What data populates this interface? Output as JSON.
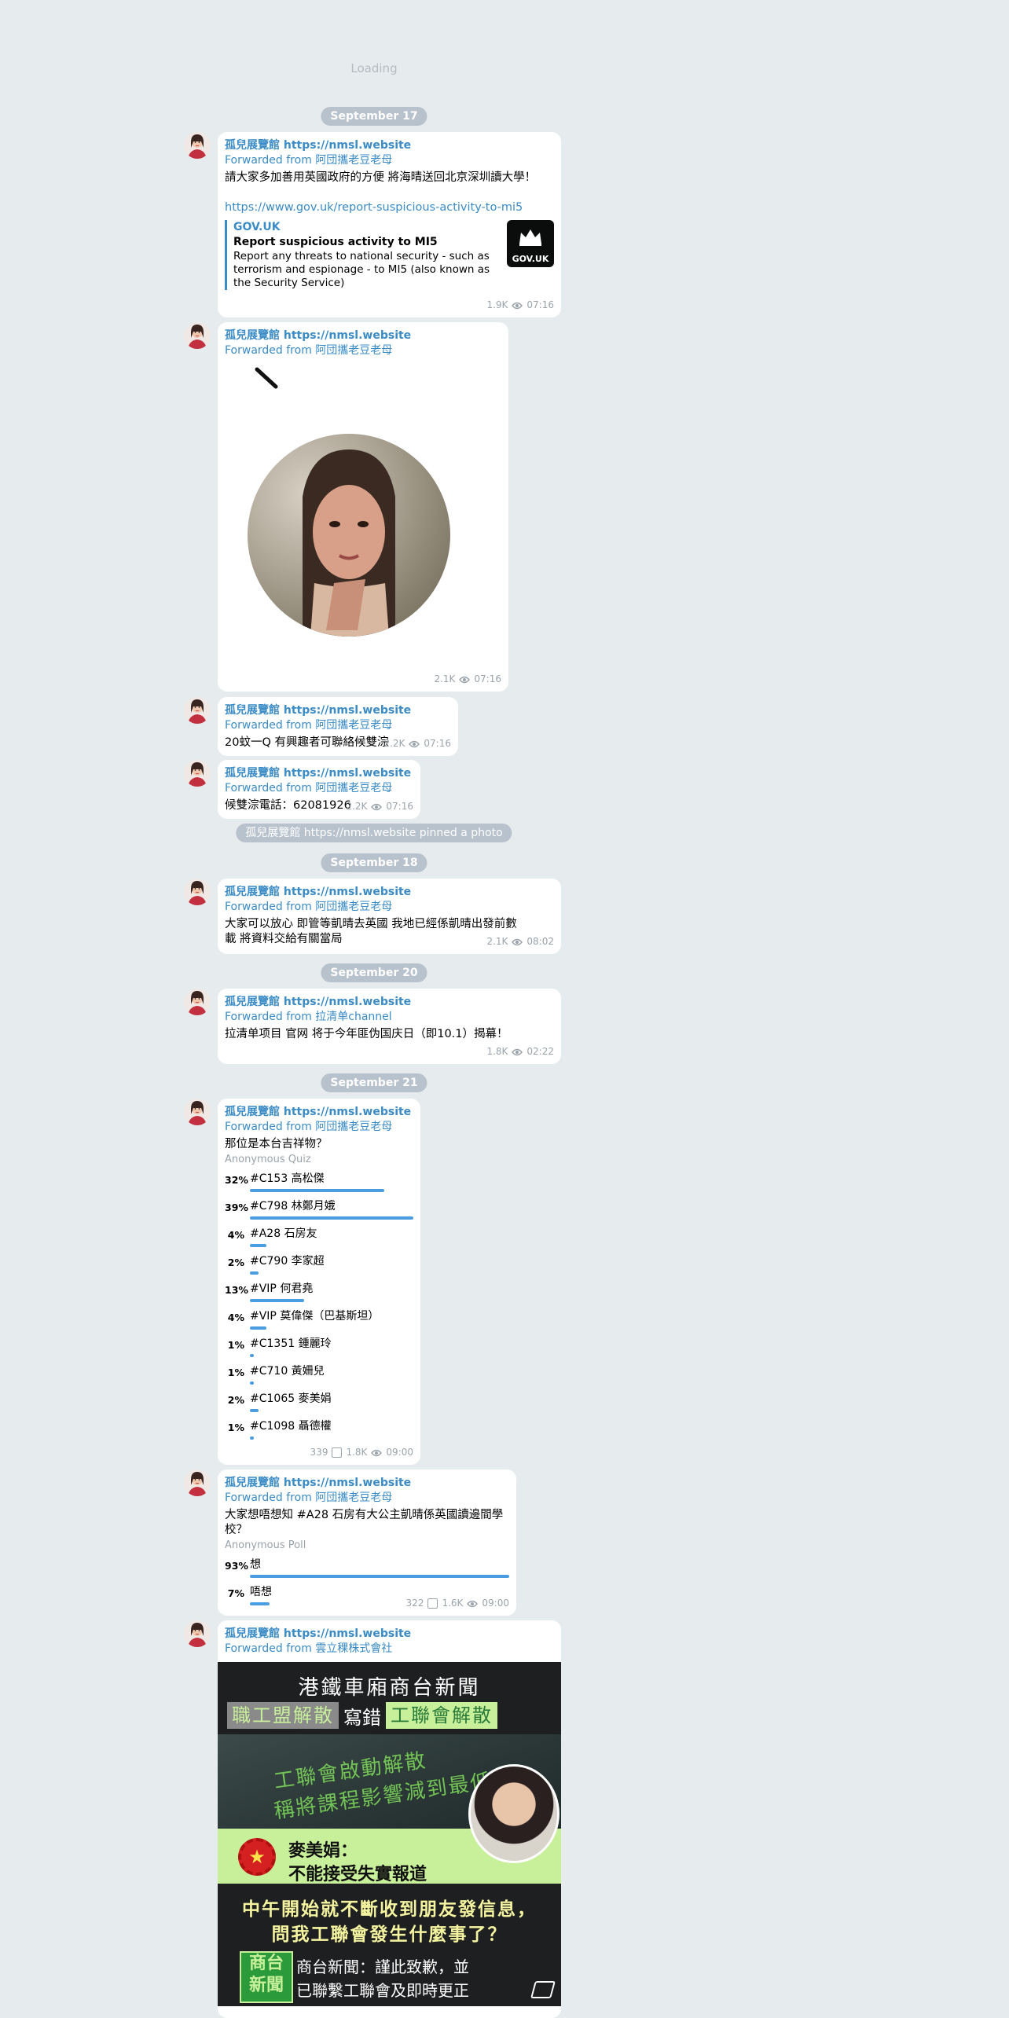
{
  "loading": "Loading",
  "channel": {
    "name": "孤兒展覽館",
    "url": "https://nmsl.website"
  },
  "eye_icon": "eye-icon",
  "dates": [
    "September 17",
    "September 18",
    "September 20",
    "September 21"
  ],
  "service_pinned": "孤兒展覽館 https://nmsl.website pinned a photo",
  "messages": {
    "m1": {
      "fwd": "Forwarded from 阿団攜老豆老母",
      "text": "請大家多加善用英國政府的方便 將海晴送回北京深圳讀大學！",
      "link": "https://www.gov.uk/report-suspicious-activity-to-mi5",
      "preview_site": "GOV.UK",
      "preview_title": "Report suspicious activity to MI5",
      "preview_desc": "Report any threats to national security - such as terrorism and espionage - to MI5 (also known as the Security Service)",
      "logo_text": "GOV.UK",
      "views": "1.9K",
      "time": "07:16"
    },
    "m2": {
      "fwd": "Forwarded from 阿団攜老豆老母",
      "views": "2.1K",
      "time": "07:16"
    },
    "m3": {
      "fwd": "Forwarded from 阿団攜老豆老母",
      "text": "20蚊一Q 有興趣者可聯絡候雙淙",
      "views": "2.2K",
      "time": "07:16"
    },
    "m4": {
      "fwd": "Forwarded from 阿団攜老豆老母",
      "text": "候雙淙電話：62081926",
      "views": "2.2K",
      "time": "07:16"
    },
    "m5": {
      "fwd": "Forwarded from 阿団攜老豆老母",
      "text": "大家可以放心 即管等凱晴去英國 我地已經係凱晴出發前數載 將資料交給有關當局",
      "views": "2.1K",
      "time": "08:02"
    },
    "m6": {
      "fwd": "Forwarded from 拉清单channel",
      "text": "拉清单项目 官网 将于今年匪伪国庆日（即10.1）揭幕！",
      "views": "1.8K",
      "time": "02:22"
    },
    "m7": {
      "fwd": "Forwarded from 阿団攜老豆老母",
      "question": "那位是本台吉祥物？",
      "kind": "Anonymous Quiz",
      "options": [
        {
          "pct": "32%",
          "label": "#C153 高松傑",
          "frac": 0.32
        },
        {
          "pct": "39%",
          "label": "#C798 林鄭月娥",
          "frac": 0.39
        },
        {
          "pct": "4%",
          "label": "#A28 石房友",
          "frac": 0.04
        },
        {
          "pct": "2%",
          "label": "#C790 李家超",
          "frac": 0.02
        },
        {
          "pct": "13%",
          "label": "#VIP 何君堯",
          "frac": 0.13
        },
        {
          "pct": "4%",
          "label": "#VIP 莫偉傑（巴基斯坦）",
          "frac": 0.04
        },
        {
          "pct": "1%",
          "label": "#C1351 鍾麗玲",
          "frac": 0.01
        },
        {
          "pct": "1%",
          "label": "#C710 黃姍兒",
          "frac": 0.01
        },
        {
          "pct": "2%",
          "label": "#C1065 麥美娟",
          "frac": 0.02
        },
        {
          "pct": "1%",
          "label": "#C1098 聶德權",
          "frac": 0.01
        }
      ],
      "voters": "339",
      "views": "1.8K",
      "time": "09:00"
    },
    "m8": {
      "fwd": "Forwarded from 阿団攜老豆老母",
      "question": "大家想唔想知 #A28 石房有大公主凱晴係英國讀邊間學校？",
      "kind": "Anonymous Poll",
      "options": [
        {
          "pct": "93%",
          "label": "想",
          "frac": 0.93
        },
        {
          "pct": "7%",
          "label": "唔想",
          "frac": 0.07
        }
      ],
      "voters": "322",
      "views": "1.6K",
      "time": "09:00"
    },
    "m9": {
      "fwd": "Forwarded from 雲立稞株式會社",
      "news": {
        "title": "港鐵車廂商台新聞",
        "box1": "職工盟解散",
        "mid": "寫錯",
        "box2": "工聯會解散",
        "train1": "工聯會啟動解散",
        "train2": "稱將課程影響減到最低",
        "name": "麥美娟：",
        "quote": "不能接受失實報道",
        "big1": "中午開始就不斷收到朋友發信息，",
        "big2": "問我工聯會發生什麼事了？",
        "logo": "商台 新聞",
        "foot1": "商台新聞：謹此致歉，並",
        "foot2": "已聯繫工聯會及即時更正"
      }
    }
  }
}
